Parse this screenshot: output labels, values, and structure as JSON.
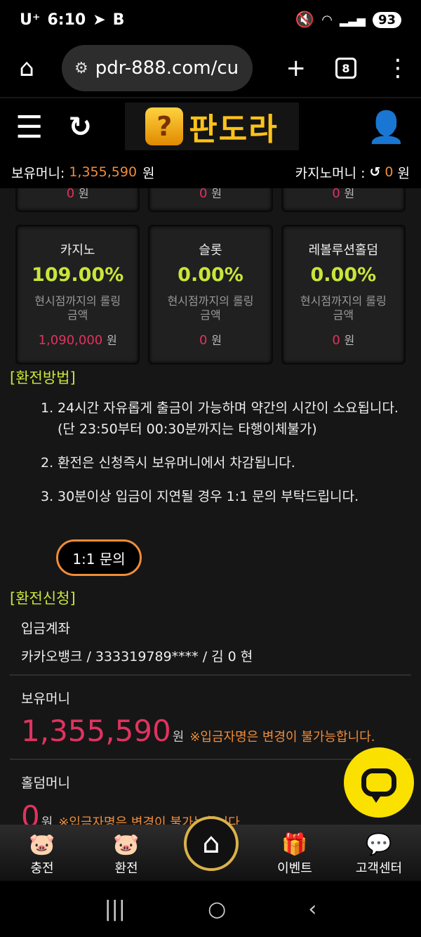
{
  "status": {
    "carrier": "U⁺",
    "time": "6:10",
    "battery": "93"
  },
  "browser": {
    "url": "pdr-888.com/cu",
    "tab_count": "8"
  },
  "header": {
    "logo_text": "판도라"
  },
  "money_bar": {
    "hold_label": "보유머니:",
    "hold_value": "1,355,590",
    "hold_unit": "원",
    "casino_label": "카지노머니 :",
    "casino_value": "0",
    "casino_unit": "원"
  },
  "top_cards": [
    {
      "amount": "0",
      "unit": "원"
    },
    {
      "amount": "0",
      "unit": "원"
    },
    {
      "amount": "0",
      "unit": "원"
    }
  ],
  "cards": [
    {
      "title": "카지노",
      "rate": "109.00%",
      "desc1": "현시점까지의 롤링",
      "desc2": "금액",
      "amount": "1,090,000",
      "unit": "원"
    },
    {
      "title": "슬롯",
      "rate": "0.00%",
      "desc1": "현시점까지의 롤링",
      "desc2": "금액",
      "amount": "0",
      "unit": "원"
    },
    {
      "title": "레볼루션홀덤",
      "rate": "0.00%",
      "desc1": "현시점까지의 롤링",
      "desc2": "금액",
      "amount": "0",
      "unit": "원"
    }
  ],
  "method": {
    "title": "[환전방법]",
    "steps": [
      {
        "num": "1.",
        "text": "24시간 자유롭게 출금이 가능하며 약간의 시간이 소요됩니다.",
        "sub": "(단 23:50부터 00:30분까지는 타행이체불가)"
      },
      {
        "num": "2.",
        "text": "환전은 신청즉시 보유머니에서 차감됩니다."
      },
      {
        "num": "3.",
        "text": "30분이상 입금이 지연될 경우 1:1 문의 부탁드립니다."
      }
    ],
    "inquiry_label": "1:1 문의"
  },
  "request": {
    "title": "[환전신청]",
    "account_label": "입금계좌",
    "account_value": "카카오뱅크 / 333319789**** / 김 0 현",
    "hold_label": "보유머니",
    "hold_value": "1,355,590",
    "hold_unit": "원",
    "note": "※입금자명은 변경이 불가능합니다.",
    "holdem_label": "홀덤머니",
    "holdem_value": "0",
    "holdem_unit": "원",
    "holdem_note": "※입금자명은 변경이 불가능합니다."
  },
  "bottom_nav": {
    "charge": "충전",
    "exchange": "환전",
    "event": "이벤트",
    "support": "고객센터"
  },
  "colors": {
    "accent_green": "#c8e63a",
    "accent_orange": "#f08c3a",
    "accent_red": "#e0335f",
    "chat_yellow": "#fae100"
  }
}
